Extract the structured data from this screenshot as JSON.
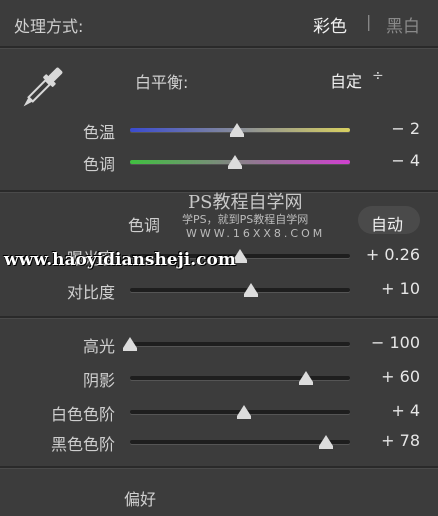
{
  "header": {
    "title": "处理方式:",
    "mode_color": "彩色",
    "separator": "|",
    "mode_bw": "黑白"
  },
  "white_balance": {
    "label": "白平衡:",
    "value": "自定",
    "dropdown_glyph": "÷"
  },
  "basic": [
    {
      "label": "色温",
      "value": "− 2",
      "fraction": 0.485
    },
    {
      "label": "色调",
      "value": "− 4",
      "fraction": 0.475
    }
  ],
  "tone": {
    "label": "色调",
    "auto_label": "自动"
  },
  "exposure": [
    {
      "label": "曝光度",
      "value": "+ 0.26",
      "fraction": 0.5
    },
    {
      "label": "对比度",
      "value": "+ 10",
      "fraction": 0.55
    }
  ],
  "tonal_range": [
    {
      "label": "高光",
      "value": "− 100",
      "fraction": 0.0
    },
    {
      "label": "阴影",
      "value": "+ 60",
      "fraction": 0.8
    },
    {
      "label": "白色色阶",
      "value": "+ 4",
      "fraction": 0.52
    },
    {
      "label": "黑色色阶",
      "value": "+ 78",
      "fraction": 0.89
    }
  ],
  "footer": {
    "preference_label": "偏好"
  },
  "watermarks": {
    "line1": "PS教程自学网",
    "line2": "学PS，就到PS教程自学网",
    "line3": "WWW.16XX8.COM",
    "line4": "www.haoyidiansheji.com"
  },
  "colors": {
    "temp_start": "#3a4bd0",
    "temp_end": "#d8d060",
    "tint_start": "#40c040",
    "tint_end": "#d040d0"
  }
}
